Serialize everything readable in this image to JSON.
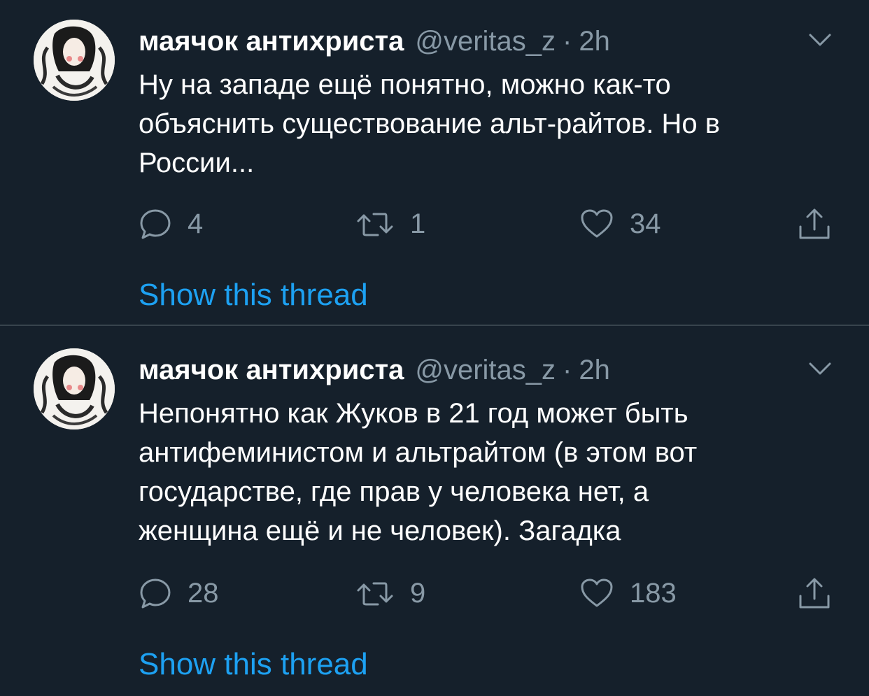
{
  "tweets": [
    {
      "name": "маячок антихриста",
      "handle": "@veritas_z",
      "separator": "·",
      "time": "2h",
      "text": "Ну на западе ещё понятно, можно как-то\nобъяснить существование альт-райтов. Но в\nРоссии...",
      "replies": "4",
      "retweets": "1",
      "likes": "34",
      "thread_link": "Show this thread"
    },
    {
      "name": "маячок антихриста",
      "handle": "@veritas_z",
      "separator": "·",
      "time": "2h",
      "text": "Непонятно как Жуков в 21 год может быть\nантифеминистом и альтрайтом (в этом вот\nгосударстве, где прав у человека нет, а\nженщина ещё и не человек). Загадка",
      "replies": "28",
      "retweets": "9",
      "likes": "183",
      "thread_link": "Show this thread"
    }
  ],
  "icons": {
    "reply": "reply-icon",
    "retweet": "retweet-icon",
    "like": "heart-icon",
    "share": "share-icon",
    "menu": "chevron-down-icon"
  },
  "colors": {
    "background": "#15202b",
    "divider": "#38444d",
    "secondary_text": "#8899a6",
    "link": "#1da1f2"
  }
}
